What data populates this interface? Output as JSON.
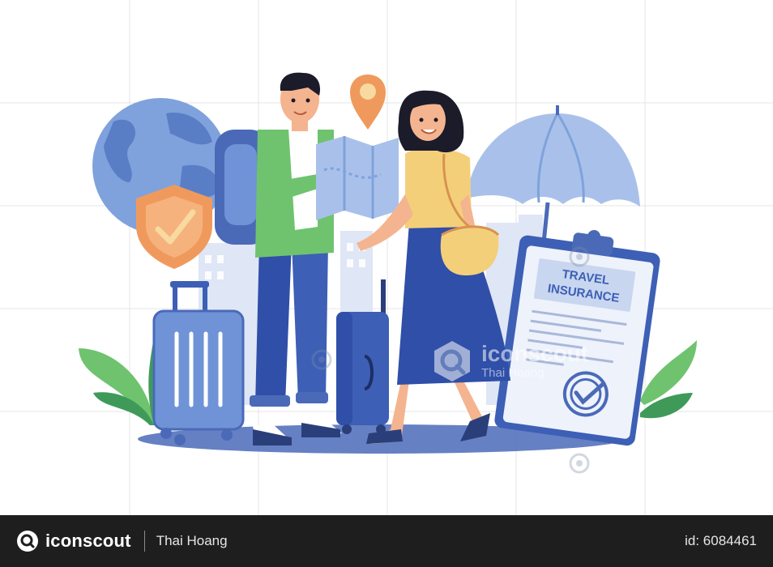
{
  "illustration": {
    "clipboard_title_line1": "TRAVEL",
    "clipboard_title_line2": "INSURANCE"
  },
  "watermark": {
    "brand": "iconscout",
    "author": "Thai Hoang"
  },
  "footer": {
    "brand": "iconscout",
    "author": "Thai Hoang",
    "asset_id": "id: 6084461"
  },
  "colors": {
    "footer_bg": "#1e1e1e",
    "primary_blue": "#3d5fb5",
    "light_blue": "#7fa2dc",
    "green": "#6fc36f",
    "orange": "#ef9a5c",
    "yellow": "#f4cf7a"
  }
}
